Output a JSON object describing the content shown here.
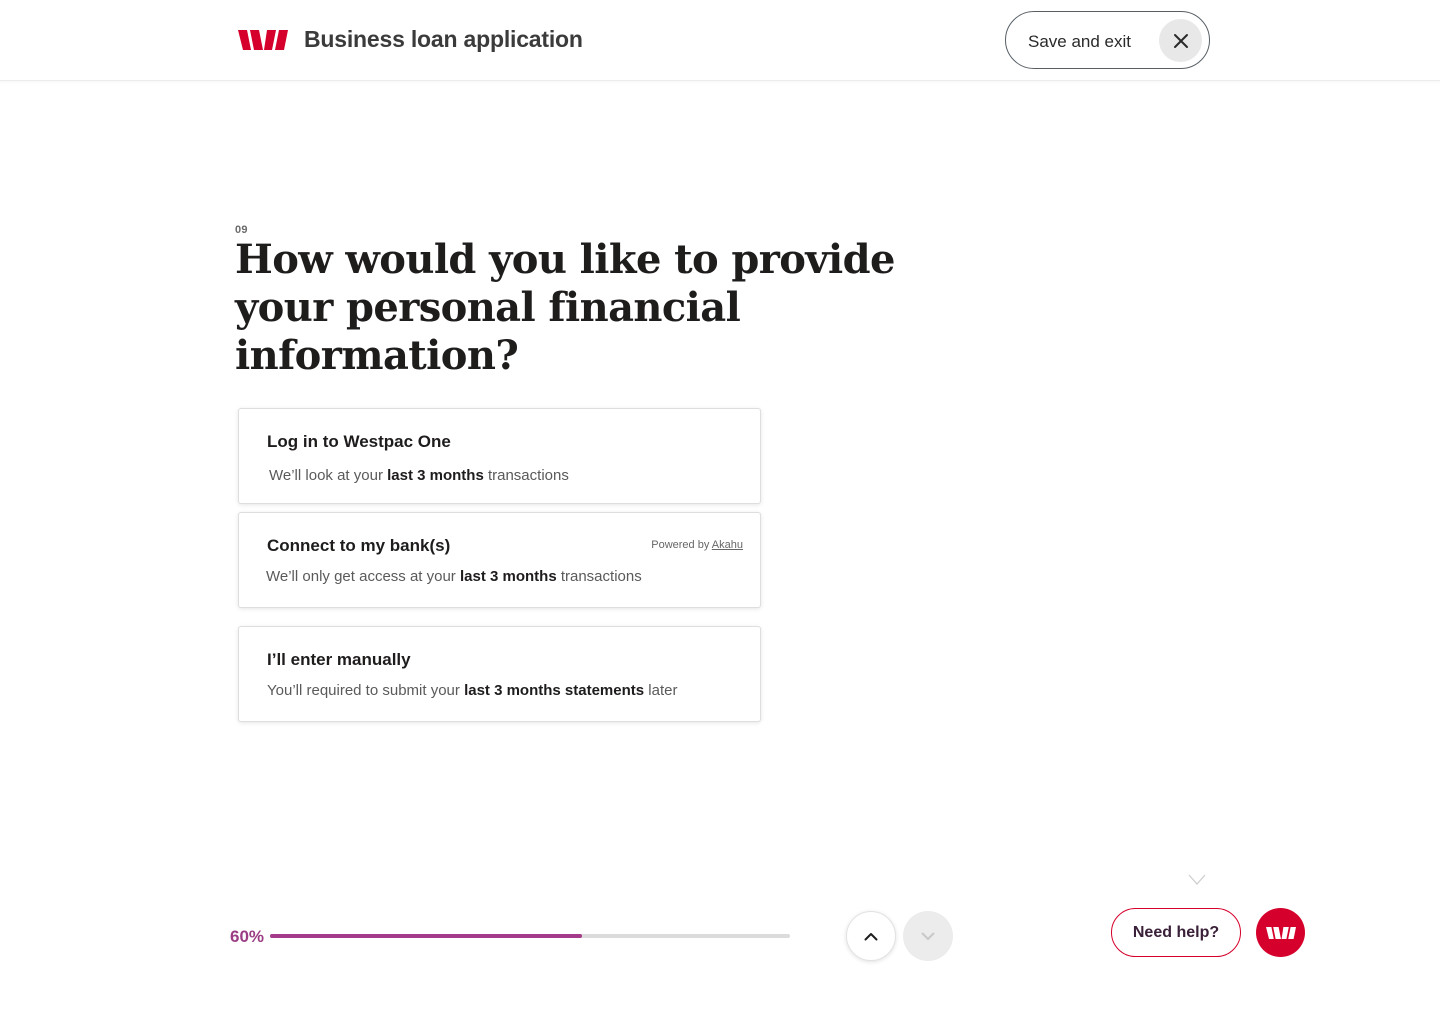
{
  "header": {
    "title": "Business loan application",
    "save_exit_label": "Save and exit"
  },
  "question": {
    "number": "09",
    "text": "How would you like to provide your personal financial information?"
  },
  "options": [
    {
      "title": "Log in to Westpac One",
      "desc_pre": "We’ll look at your ",
      "desc_bold": "last 3 months",
      "desc_post": " transactions"
    },
    {
      "title": "Connect to my bank(s)",
      "desc_pre": "We’ll only get access at your ",
      "desc_bold": "last 3 months",
      "desc_post": " transactions",
      "powered_by": "Powered by",
      "powered_link": "Akahu"
    },
    {
      "title": "I’ll enter manually",
      "desc_pre": "You’ll required to submit your ",
      "desc_bold": "last 3 months statements",
      "desc_post": " later"
    }
  ],
  "progress": {
    "label": "60%",
    "value": 0.6
  },
  "help": {
    "label": "Need help?"
  },
  "colors": {
    "brand_red": "#d5002b",
    "progress": "#a43a8a",
    "progress_label": "#9b3d84"
  },
  "icons": {
    "logo": "westpac-logo",
    "close": "close-icon",
    "up": "chevron-up-icon",
    "down": "chevron-down-icon"
  }
}
